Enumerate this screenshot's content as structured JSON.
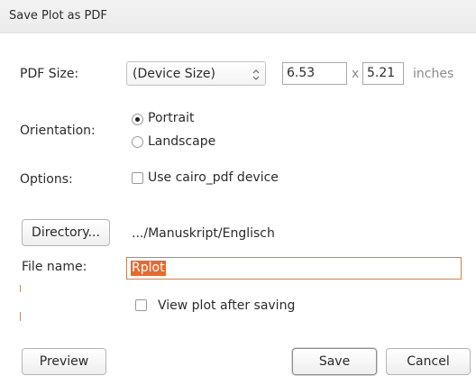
{
  "window": {
    "title": "Save Plot as PDF"
  },
  "pdf_size": {
    "label": "PDF Size:",
    "selected": "(Device Size)",
    "width": "6.53",
    "separator": "x",
    "height": "5.21",
    "unit": "inches"
  },
  "orientation": {
    "label": "Orientation:",
    "options": [
      "Portrait",
      "Landscape"
    ],
    "selected": "Portrait"
  },
  "options": {
    "label": "Options:",
    "cairo_label": "Use cairo_pdf device",
    "cairo_checked": false
  },
  "directory": {
    "button_label": "Directory...",
    "path": ".../Manuskript/Englisch"
  },
  "file": {
    "label": "File name:",
    "value": "Rplot"
  },
  "view_after": {
    "label": "View plot after saving",
    "checked": false
  },
  "buttons": {
    "preview": "Preview",
    "save": "Save",
    "cancel": "Cancel"
  },
  "colors": {
    "selection": "#e8692f",
    "focus_border": "#e07b3a"
  },
  "icons": {
    "select_arrows": "updown-arrows-icon"
  }
}
